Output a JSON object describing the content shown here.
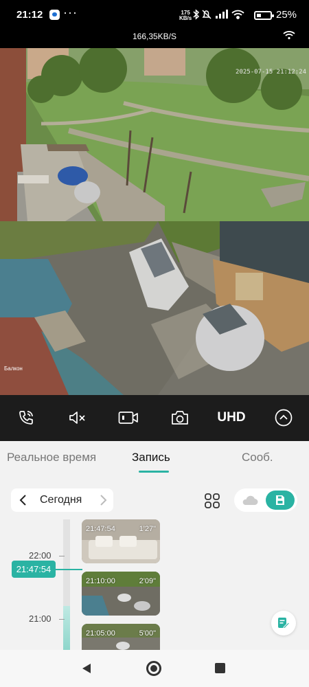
{
  "status_bar": {
    "time": "21:12",
    "dots": "···",
    "net_speed_value": "175",
    "net_speed_unit": "KB/s",
    "battery": "25%",
    "icons": [
      "bluetooth-icon",
      "mute-icon",
      "signal-icon",
      "wifi-icon",
      "battery-icon"
    ]
  },
  "camera": {
    "header_speed": "166,35KB/S",
    "timestamp": "2025-07-15 21:12:24",
    "view2_label": "Балкон"
  },
  "controls": {
    "uhd_label": "UHD",
    "items": [
      "call-icon",
      "mute-icon",
      "record-icon",
      "snapshot-icon",
      "uhd",
      "expand-up-icon"
    ]
  },
  "tabs": {
    "realtime": "Реальное время",
    "record": "Запись",
    "messages": "Сооб.",
    "active": "record"
  },
  "date": {
    "label": "Сегодня"
  },
  "timeline": {
    "hour_labels": [
      "22:00",
      "21:00"
    ],
    "current": "21:47:54",
    "clips": [
      {
        "time": "21:47:54",
        "duration": "1'27\""
      },
      {
        "time": "21:10:00",
        "duration": "2'09\""
      },
      {
        "time": "21:05:00",
        "duration": "5'00\""
      }
    ]
  },
  "colors": {
    "accent": "#2ab3a3",
    "control_bar": "#1c1c1c"
  }
}
